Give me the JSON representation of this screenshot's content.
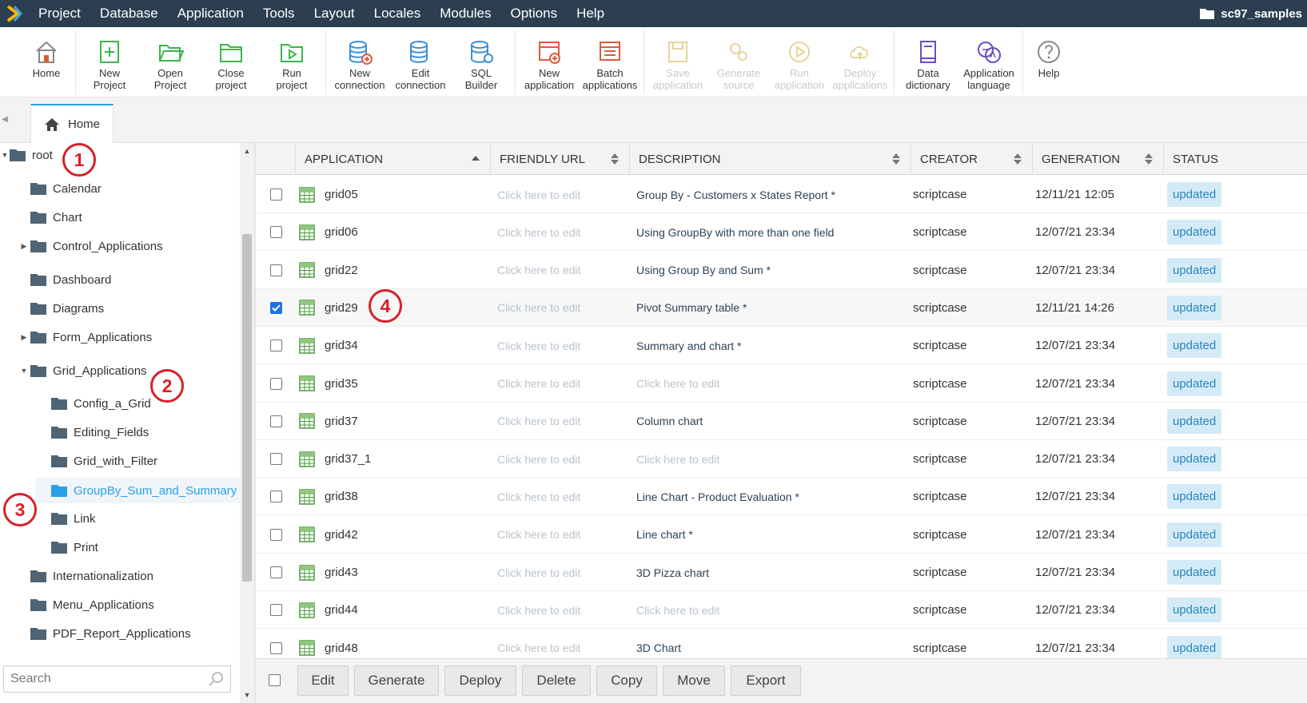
{
  "menubar": {
    "items": [
      "Project",
      "Database",
      "Application",
      "Tools",
      "Layout",
      "Locales",
      "Modules",
      "Options",
      "Help"
    ],
    "project_name": "sc97_samples"
  },
  "toolbar": {
    "home": "Home",
    "new_project": "New\nProject",
    "open_project": "Open\nProject",
    "close_project": "Close\nproject",
    "run_project": "Run\nproject",
    "new_connection": "New\nconnection",
    "edit_connection": "Edit\nconnection",
    "sql_builder": "SQL\nBuilder",
    "new_application": "New\napplication",
    "batch_applications": "Batch\napplications",
    "save_application": "Save\napplication",
    "generate_source": "Generate\nsource",
    "run_application": "Run\napplication",
    "deploy_applications": "Deploy\napplications",
    "data_dictionary": "Data\ndictionary",
    "application_language": "Application\nlanguage",
    "help": "Help"
  },
  "tabs": {
    "home": "Home"
  },
  "tree": {
    "root": "root",
    "items": [
      "Calendar",
      "Chart",
      "Control_Applications",
      "Dashboard",
      "Diagrams",
      "Form_Applications",
      "Grid_Applications",
      "Config_a_Grid",
      "Editing_Fields",
      "Grid_with_Filter",
      "GroupBy_Sum_and_Summary",
      "Link",
      "Print",
      "Internationalization",
      "Menu_Applications",
      "PDF_Report_Applications"
    ],
    "search_placeholder": "Search"
  },
  "grid": {
    "columns": [
      "APPLICATION",
      "FRIENDLY URL",
      "DESCRIPTION",
      "CREATOR",
      "GENERATION",
      "STATUS"
    ],
    "rows": [
      {
        "app": "grid05",
        "url": "Click here to edit",
        "desc": "Group By - Customers x States Report *",
        "creator": "scriptcase",
        "gen": "12/11/21 12:05",
        "status": "updated"
      },
      {
        "app": "grid06",
        "url": "Click here to edit",
        "desc": "Using GroupBy with more than one field",
        "creator": "scriptcase",
        "gen": "12/07/21 23:34",
        "status": "updated"
      },
      {
        "app": "grid22",
        "url": "Click here to edit",
        "desc": "Using Group By and Sum *",
        "creator": "scriptcase",
        "gen": "12/07/21 23:34",
        "status": "updated"
      },
      {
        "app": "grid29",
        "url": "Click here to edit",
        "desc": "Pivot Summary table *",
        "creator": "scriptcase",
        "gen": "12/11/21 14:26",
        "status": "updated"
      },
      {
        "app": "grid34",
        "url": "Click here to edit",
        "desc": "Summary and chart *",
        "creator": "scriptcase",
        "gen": "12/07/21 23:34",
        "status": "updated"
      },
      {
        "app": "grid35",
        "url": "Click here to edit",
        "desc": "Click here to edit",
        "creator": "scriptcase",
        "gen": "12/07/21 23:34",
        "status": "updated"
      },
      {
        "app": "grid37",
        "url": "Click here to edit",
        "desc": "Column chart",
        "creator": "scriptcase",
        "gen": "12/07/21 23:34",
        "status": "updated"
      },
      {
        "app": "grid37_1",
        "url": "Click here to edit",
        "desc": "Click here to edit",
        "creator": "scriptcase",
        "gen": "12/07/21 23:34",
        "status": "updated"
      },
      {
        "app": "grid38",
        "url": "Click here to edit",
        "desc": "Line Chart - Product Evaluation *",
        "creator": "scriptcase",
        "gen": "12/07/21 23:34",
        "status": "updated"
      },
      {
        "app": "grid42",
        "url": "Click here to edit",
        "desc": "Line chart *",
        "creator": "scriptcase",
        "gen": "12/07/21 23:34",
        "status": "updated"
      },
      {
        "app": "grid43",
        "url": "Click here to edit",
        "desc": "3D Pizza chart",
        "creator": "scriptcase",
        "gen": "12/07/21 23:34",
        "status": "updated"
      },
      {
        "app": "grid44",
        "url": "Click here to edit",
        "desc": "Click here to edit",
        "creator": "scriptcase",
        "gen": "12/07/21 23:34",
        "status": "updated"
      },
      {
        "app": "grid48",
        "url": "Click here to edit",
        "desc": "3D Chart",
        "creator": "scriptcase",
        "gen": "12/07/21 23:34",
        "status": "updated"
      }
    ]
  },
  "actions": [
    "Edit",
    "Generate",
    "Deploy",
    "Delete",
    "Copy",
    "Move",
    "Export"
  ],
  "markers": [
    "1",
    "2",
    "3",
    "4"
  ]
}
